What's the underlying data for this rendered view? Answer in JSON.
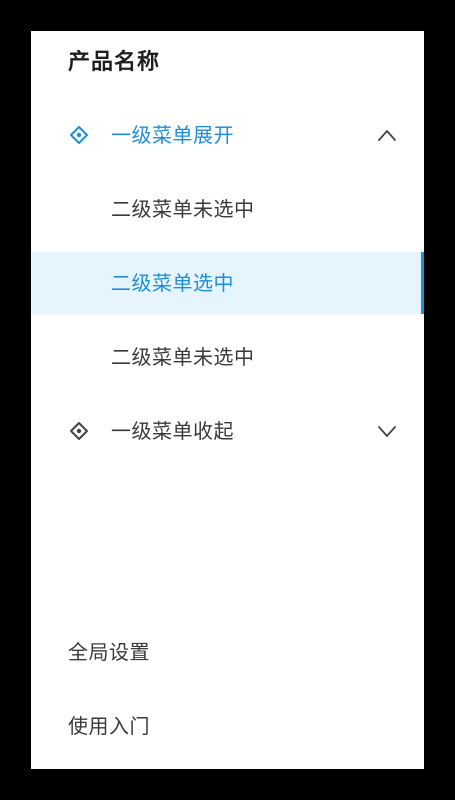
{
  "sidebar": {
    "product_title": "产品名称",
    "menu": [
      {
        "label": "一级菜单展开",
        "icon": "diamond-nav-icon",
        "state": "expanded",
        "chevron": "chevron-up-icon"
      },
      {
        "label": "二级菜单未选中",
        "state": "unselected"
      },
      {
        "label": "二级菜单选中",
        "state": "selected"
      },
      {
        "label": "二级菜单未选中",
        "state": "unselected"
      },
      {
        "label": "一级菜单收起",
        "icon": "diamond-nav-icon",
        "state": "collapsed",
        "chevron": "chevron-down-icon"
      }
    ],
    "footer": {
      "global_settings": "全局设置",
      "getting_started": "使用入门"
    }
  },
  "colors": {
    "accent": "#1e8fdc",
    "selected_background": "#e6f4fd",
    "text": "#3a3a3a",
    "page_background": "#000000",
    "panel_background": "#ffffff"
  }
}
